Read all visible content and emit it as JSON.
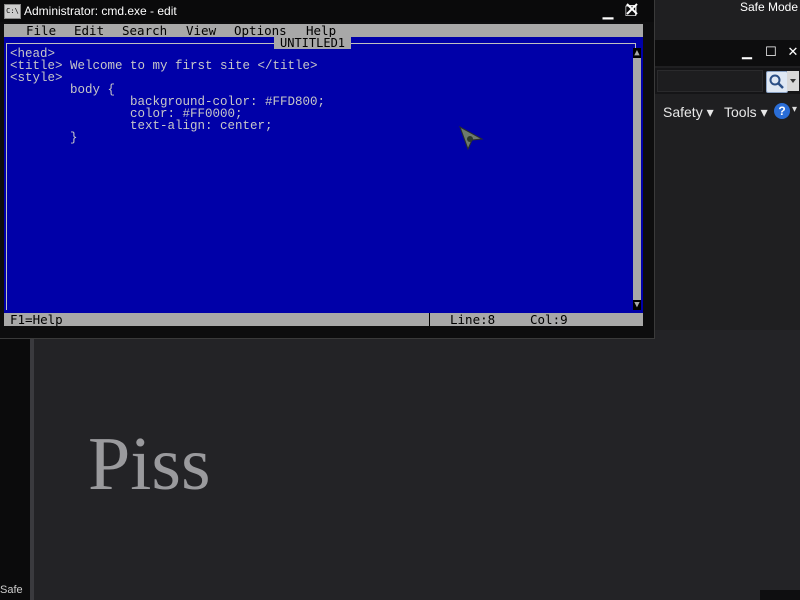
{
  "background_browser": {
    "safe_mode": "Safe Mode",
    "command_bar": {
      "safety": "Safety ▾",
      "tools": "Tools ▾",
      "help": "?"
    },
    "page_heading": "Piss",
    "status_left": "Safe"
  },
  "cmd_window": {
    "title": "Administrator: cmd.exe - edit",
    "icon_text": "C:\\",
    "buttons": {
      "minimize": "▁",
      "restore": "❐",
      "close": "✕"
    }
  },
  "editor": {
    "menu": [
      "File",
      "Edit",
      "Search",
      "View",
      "Options",
      "Help"
    ],
    "document_title": "UNTITLED1",
    "lines": [
      "<head>",
      "<title> Welcome to my first site </title>",
      "<style>",
      "        body {",
      "                background-color: #FFD800;",
      "                color: #FF0000;",
      "                text-align: center;",
      "        }"
    ],
    "status": {
      "help": "F1=Help",
      "line": "Line:8",
      "col": "Col:9"
    }
  }
}
